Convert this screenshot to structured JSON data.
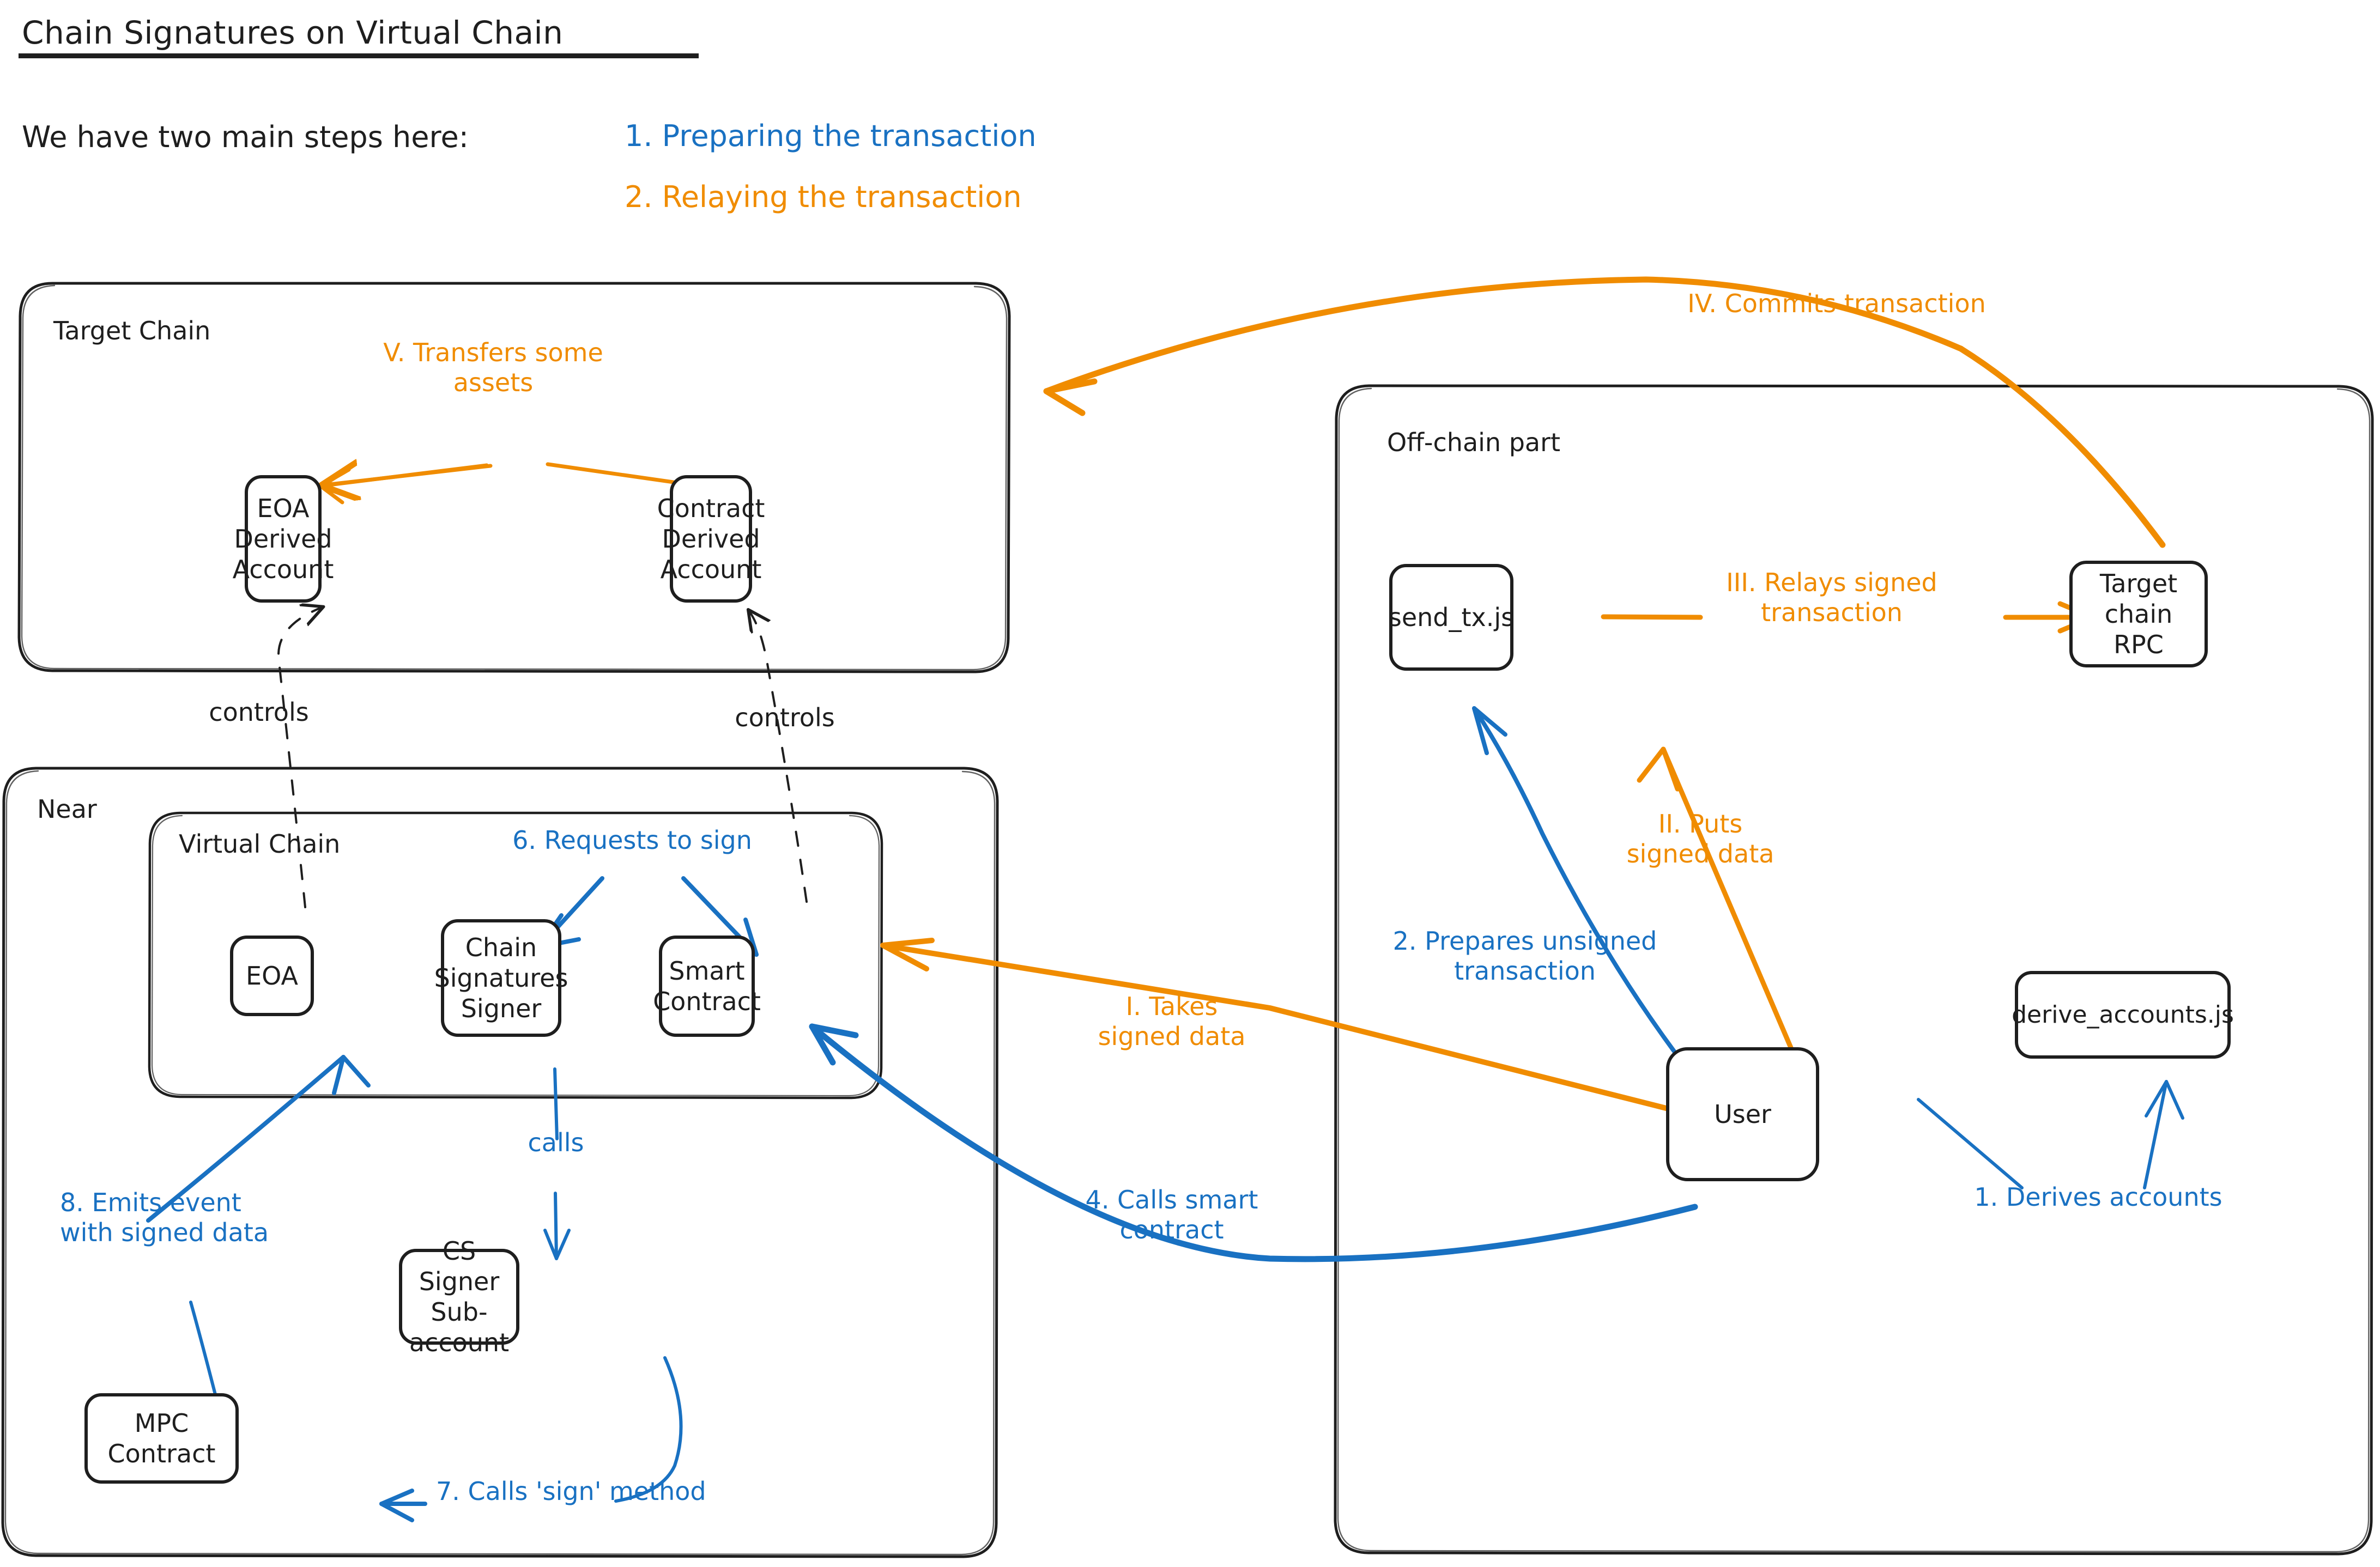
{
  "colors": {
    "blue": "#1971c2",
    "orange": "#f08c00",
    "ink": "#1e1e1e",
    "background": "#ffffff"
  },
  "header": {
    "title": "Chain Signatures on Virtual Chain",
    "intro": "We have two main steps here:",
    "steps": [
      {
        "label": "1. Preparing the transaction",
        "color": "blue"
      },
      {
        "label": "2. Relaying the transaction",
        "color": "orange"
      }
    ]
  },
  "groups": {
    "target_chain": "Target Chain",
    "near": "Near",
    "virtual_chain": "Virtual Chain",
    "off_chain": "Off-chain part"
  },
  "nodes": {
    "eoa_derived_account": "EOA\nDerived\nAccount",
    "contract_derived_account": "Contract\nDerived\nAccount",
    "eoa": "EOA",
    "chain_signatures_signer": "Chain\nSignatures\nSigner",
    "smart_contract": "Smart\nContract",
    "cs_signer_subaccount": "CS Signer\nSub-account",
    "mpc_contract": "MPC Contract",
    "send_tx_js": "send_tx.js",
    "target_chain_rpc": "Target chain\nRPC",
    "user": "User",
    "derive_accounts_js": "derive_accounts.js"
  },
  "edges": [
    {
      "id": "commits-transaction",
      "label": "IV. Commits transaction",
      "color": "orange"
    },
    {
      "id": "transfers-some-assets",
      "label": "V. Transfers some\nassets",
      "color": "orange"
    },
    {
      "id": "relays-signed-transaction",
      "label": "III. Relays signed\ntransaction",
      "color": "orange"
    },
    {
      "id": "puts-signed-data",
      "label": "II. Puts\nsigned data",
      "color": "orange"
    },
    {
      "id": "takes-signed-data",
      "label": "I. Takes\nsigned data",
      "color": "orange"
    },
    {
      "id": "prepares-unsigned-transaction",
      "label": "2. Prepares unsigned\ntransaction",
      "color": "blue"
    },
    {
      "id": "derives-accounts",
      "label": "1. Derives accounts",
      "color": "blue"
    },
    {
      "id": "calls-smart-contract",
      "label": "4. Calls smart\ncontract",
      "color": "blue"
    },
    {
      "id": "requests-to-sign",
      "label": "6. Requests to sign",
      "color": "blue"
    },
    {
      "id": "calls",
      "label": "calls",
      "color": "blue"
    },
    {
      "id": "calls-sign-method",
      "label": "7. Calls 'sign' method",
      "color": "blue"
    },
    {
      "id": "emits-event-with-signed-data",
      "label": "8. Emits event\nwith signed data",
      "color": "blue"
    },
    {
      "id": "controls-left",
      "label": "controls",
      "color": "black"
    },
    {
      "id": "controls-right",
      "label": "controls",
      "color": "black"
    }
  ]
}
